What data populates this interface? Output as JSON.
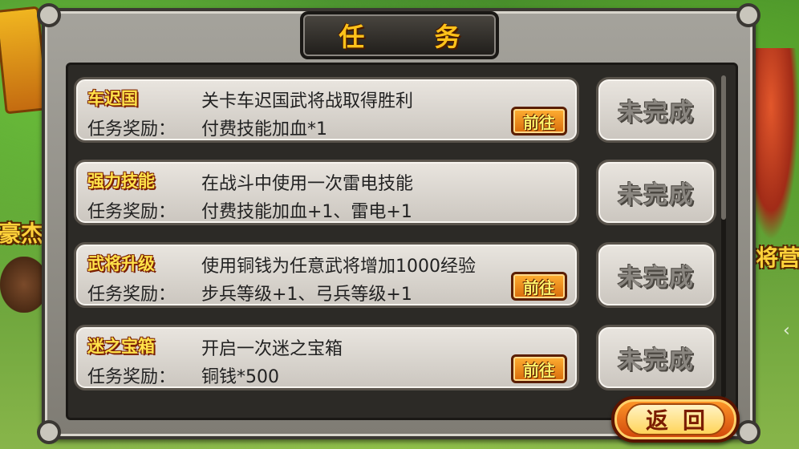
{
  "title": "任 务",
  "background": {
    "left_text": "豪杰馆",
    "right_text": "将营"
  },
  "reward_label": "任务奖励：",
  "goto_label": "前往",
  "status_label": "未完成",
  "back_label": "返回",
  "tasks": [
    {
      "name": "车迟国",
      "desc": "关卡车迟国武将战取得胜利",
      "reward": "付费技能加血*1",
      "has_goto": true,
      "status": "未完成"
    },
    {
      "name": "强力技能",
      "desc": "在战斗中使用一次雷电技能",
      "reward": "付费技能加血+1、雷电+1",
      "has_goto": false,
      "status": "未完成"
    },
    {
      "name": "武将升级",
      "desc": "使用铜钱为任意武将增加1000经验",
      "reward": "步兵等级+1、弓兵等级+1",
      "has_goto": true,
      "status": "未完成"
    },
    {
      "name": "迷之宝箱",
      "desc": "开启一次迷之宝箱",
      "reward": "铜钱*500",
      "has_goto": true,
      "status": "未完成"
    }
  ],
  "colors": {
    "title_gold": "#ffc21a",
    "name_yellow": "#ffe24a",
    "goto_orange": "#d86a0a",
    "status_gray": "#8a8680"
  }
}
